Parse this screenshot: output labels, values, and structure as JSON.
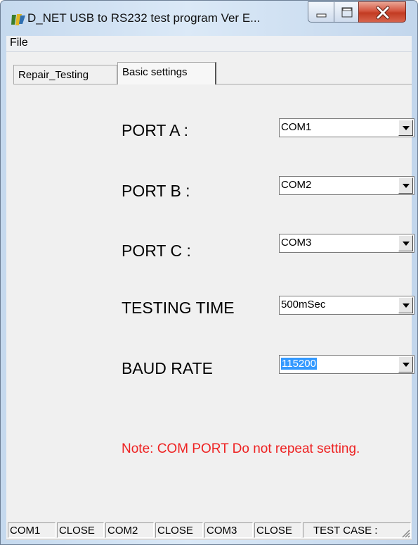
{
  "window": {
    "title": "D_NET USB to RS232 test program Ver E...",
    "minimize_label": "Minimize",
    "maximize_label": "Maximize",
    "close_label": "Close"
  },
  "menu": {
    "file": "File"
  },
  "tabs": {
    "repair": "Repair_Testing",
    "basic": "Basic settings",
    "active": "Basic settings"
  },
  "settings": {
    "port_a": {
      "label": "PORT A :",
      "value": "COM1"
    },
    "port_b": {
      "label": "PORT B :",
      "value": "COM2"
    },
    "port_c": {
      "label": "PORT C :",
      "value": "COM3"
    },
    "testing_time": {
      "label": "TESTING TIME",
      "value": "500mSec"
    },
    "baud_rate": {
      "label": "BAUD RATE",
      "value": "115200"
    }
  },
  "note": "Note: COM PORT Do not repeat setting.",
  "status": {
    "com1": "COM1",
    "com1_state": "CLOSE",
    "com2": "COM2",
    "com2_state": "CLOSE",
    "com3": "COM3",
    "com3_state": "CLOSE",
    "test_case": "TEST CASE :"
  },
  "colors": {
    "note": "#ee2222",
    "selection": "#3399ff",
    "close_button": "#c23b22"
  },
  "icons": {
    "app": "app-logo-icon",
    "minimize": "minimize-icon",
    "maximize": "maximize-icon",
    "close": "close-icon",
    "dropdown": "dropdown-arrow-icon",
    "grip": "resize-grip-icon"
  }
}
